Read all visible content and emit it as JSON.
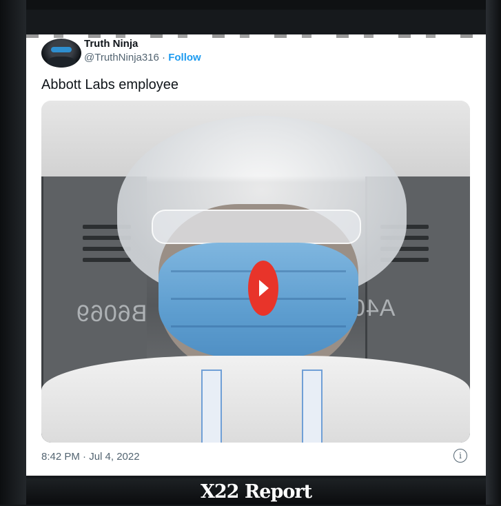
{
  "tweet": {
    "display_name": "Truth Ninja",
    "handle": "@TruthNinja316",
    "separator": " · ",
    "follow_label": "Follow",
    "text": "Abbott Labs employee",
    "timestamp": "8:42 PM · Jul 4, 2022",
    "info_icon": "info-icon",
    "follow_color": "#1d9bf0"
  },
  "media": {
    "type": "video",
    "play_icon": "play-icon",
    "play_color": "#e8342a",
    "locker_labels": [
      "B6069",
      "A40"
    ]
  },
  "footer": {
    "label": "X22 Report"
  }
}
